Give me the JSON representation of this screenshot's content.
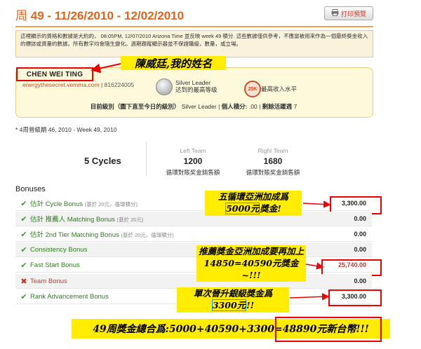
{
  "header": {
    "week_prefix": "周 ",
    "week_range": "49 - 11/26/2010 - 12/02/2010",
    "print_label": "打印預覽"
  },
  "notice": {
    "text": "這裡顯示的資格和數據是大約的， 08:05PM, 12/07/2010 Arizona Time 並反映 week 49 積分. 這些數據僅供參考，不應當被用來作為一個最終獎金收入的標誌或資量的數據。所有數字均會隨生變化。週期跟蹤顯示器並不保證職級，數量，或立場。"
  },
  "profile": {
    "name": "CHEN WEI TING",
    "site": "energythesecret.vemma.com",
    "id_sep": " | ",
    "member_id": "816224005",
    "rank_title": "Silver Leader",
    "rank_caption": "达到的最高等级",
    "income_badge": "25K",
    "income_caption": "最高收入水平",
    "status_label": "目前級別（圖下直至今日的級別）",
    "status_rank": "Silver Leader",
    "points_label": "個人積分:",
    "points_value": ".00",
    "weeks_label": "剩餘活躍週",
    "weeks_value": "7"
  },
  "period": "* 4周晉級期 46, 2010 - Week 49, 2010",
  "cycles": {
    "label": "5 Cycles",
    "left": {
      "title": "Left Team",
      "value": "1200",
      "sub": "循環對賬奖金銷售額"
    },
    "right": {
      "title": "Right Team",
      "value": "1680",
      "sub": "循環對賬奖金銷售額"
    }
  },
  "bonuses": {
    "heading": "Bonuses",
    "rows": [
      {
        "label": "估計 Cycle Bonus",
        "note": "(基於 20元，循環積分)",
        "amount": "3,300.00",
        "status": "ok"
      },
      {
        "label": "估計 推薦人 Matching Bonus",
        "note": "(基於 20元)",
        "amount": "0.00",
        "status": "ok"
      },
      {
        "label": "估計 2nd Tier Matching Bonus",
        "note": "(基於 20元，循環積分)",
        "amount": "0.00",
        "status": "ok"
      },
      {
        "label": "Consistency Bonus",
        "note": "",
        "amount": "0.00",
        "status": "ok"
      },
      {
        "label": "Fast Start Bonus",
        "note": "",
        "amount": "25,740.00",
        "status": "ok"
      },
      {
        "label": "Team Bonus",
        "note": "",
        "amount": "0.00",
        "status": "bad"
      },
      {
        "label": "Rank Advancement Bonus",
        "note": "",
        "amount": "3,300.00",
        "status": "ok"
      }
    ]
  },
  "annotations": {
    "name_note": "陳威廷,我的姓名",
    "cycle_note_1": "五循環亞洲加成爲",
    "cycle_note_2": "5000元",
    "cycle_note_3": "獎金!",
    "fast_note": "推薦獎金亞洲加成要再加上14850=40590元獎金~!!!",
    "rank_note_1": "單次晉升銀級獎金爲",
    "rank_note_2": "3300元",
    "rank_note_3": "!!",
    "total_note": "49周獎金總合爲:5000+40590+3300=48890元新台幣!!!"
  },
  "colors": {
    "accent_orange": "#e0641c",
    "annotation_yellow": "#ffec00",
    "annotation_red": "#ee0000",
    "annotation_blue": "#1e9ad6",
    "ok_green": "#3a9a2b"
  }
}
